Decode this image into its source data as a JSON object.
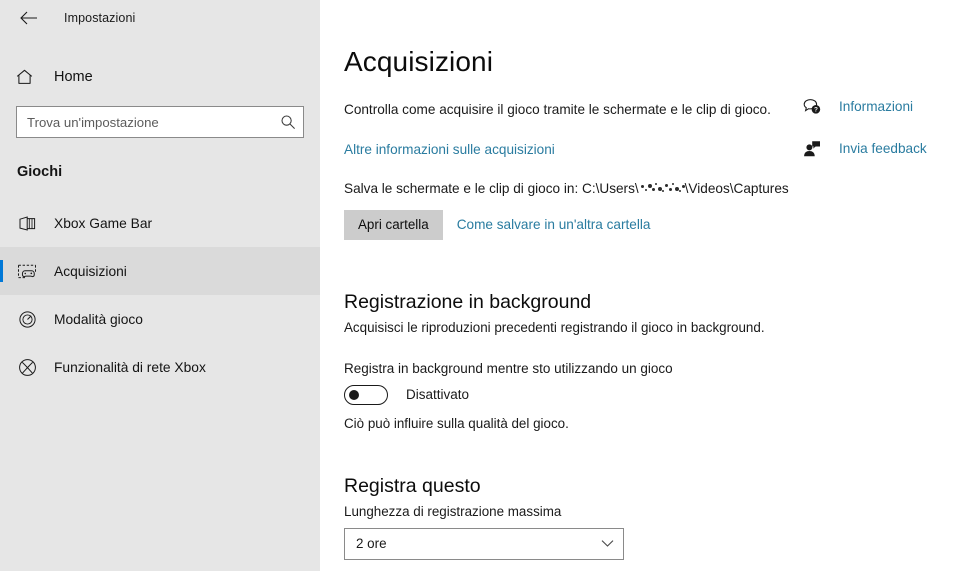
{
  "window": {
    "app_title": "Impostazioni",
    "back_icon": "back-arrow-icon"
  },
  "sidebar": {
    "home": {
      "label": "Home",
      "icon": "home-icon"
    },
    "search": {
      "placeholder": "Trova un'impostazione",
      "value": "",
      "icon": "search-icon"
    },
    "group_title": "Giochi",
    "items": [
      {
        "label": "Xbox Game Bar",
        "icon": "game-bar-icon",
        "selected": false
      },
      {
        "label": "Acquisizioni",
        "icon": "captures-icon",
        "selected": true
      },
      {
        "label": "Modalità gioco",
        "icon": "game-mode-gauge-icon",
        "selected": false
      },
      {
        "label": "Funzionalità di rete Xbox",
        "icon": "xbox-icon",
        "selected": false
      }
    ],
    "selection_accent": "#0078d7"
  },
  "main": {
    "page_title": "Acquisizioni",
    "description": "Controlla come acquisire il gioco tramite le schermate e le clip di gioco.",
    "more_info_link": "Altre informazioni sulle acquisizioni",
    "save_path_prefix": "Salva le schermate e le clip di gioco in: C:\\Users\\",
    "save_path_suffix": "\\Videos\\Captures",
    "open_folder_button": "Apri cartella",
    "other_folder_link": "Come salvare in un'altra cartella",
    "background_section": {
      "heading": "Registrazione in background",
      "subtitle": "Acquisisci le riproduzioni precedenti registrando il gioco in background.",
      "toggle_label": "Registra in background mentre sto utilizzando un gioco",
      "toggle_state": "Disattivato",
      "note": "Ciò può influire sulla qualità del gioco."
    },
    "record_section": {
      "heading": "Registra questo",
      "field_label": "Lunghezza di registrazione massima",
      "selected_value": "2 ore"
    }
  },
  "rail": {
    "items": [
      {
        "label": "Informazioni",
        "icon": "help-bubble-icon"
      },
      {
        "label": "Invia feedback",
        "icon": "feedback-person-icon"
      }
    ],
    "link_color": "#2a7ca0"
  }
}
